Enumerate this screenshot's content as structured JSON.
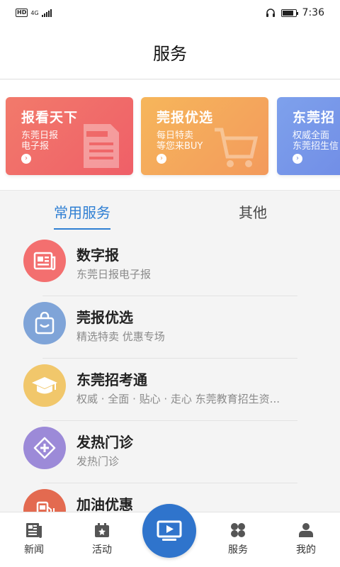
{
  "status_bar": {
    "hd": "HD",
    "network": "4G",
    "time": "7:36"
  },
  "header": {
    "title": "服务"
  },
  "banners": [
    {
      "title": "报看天下",
      "line1": "东莞日报",
      "line2": "电子报",
      "color": "#ef6a6a"
    },
    {
      "title": "莞报优选",
      "line1": "每日特卖",
      "line2": "等您来BUY",
      "color": "#f4a65c"
    },
    {
      "title": "东莞招",
      "line1": "权威全面",
      "line2": "东莞招生信",
      "color": "#7793e9"
    }
  ],
  "tabs": {
    "active": "常用服务",
    "other": "其他"
  },
  "services": [
    {
      "name": "数字报",
      "desc": "东莞日报电子报",
      "icon": "newspaper-icon",
      "color": "#f36f6f"
    },
    {
      "name": "莞报优选",
      "desc": "精选特卖 优惠专场",
      "icon": "shopping-bag-icon",
      "color": "#7fa4d8"
    },
    {
      "name": "东莞招考通",
      "desc": "权威 · 全面 · 贴心 · 走心 东莞教育招生资...",
      "icon": "graduation-cap-icon",
      "color": "#f1c76b"
    },
    {
      "name": "发热门诊",
      "desc": "发热门诊",
      "icon": "medical-cross-icon",
      "color": "#9c8ad8"
    },
    {
      "name": "加油优惠",
      "desc": "",
      "icon": "fuel-pump-icon",
      "color": "#e36a50"
    }
  ],
  "bottom_nav": [
    {
      "label": "新闻",
      "icon": "news-icon"
    },
    {
      "label": "活动",
      "icon": "calendar-star-icon"
    },
    {
      "label": "",
      "icon": "tv-play-icon"
    },
    {
      "label": "服务",
      "icon": "grid-icon"
    },
    {
      "label": "我的",
      "icon": "user-icon"
    }
  ],
  "colors": {
    "accent": "#2f7fd3"
  }
}
